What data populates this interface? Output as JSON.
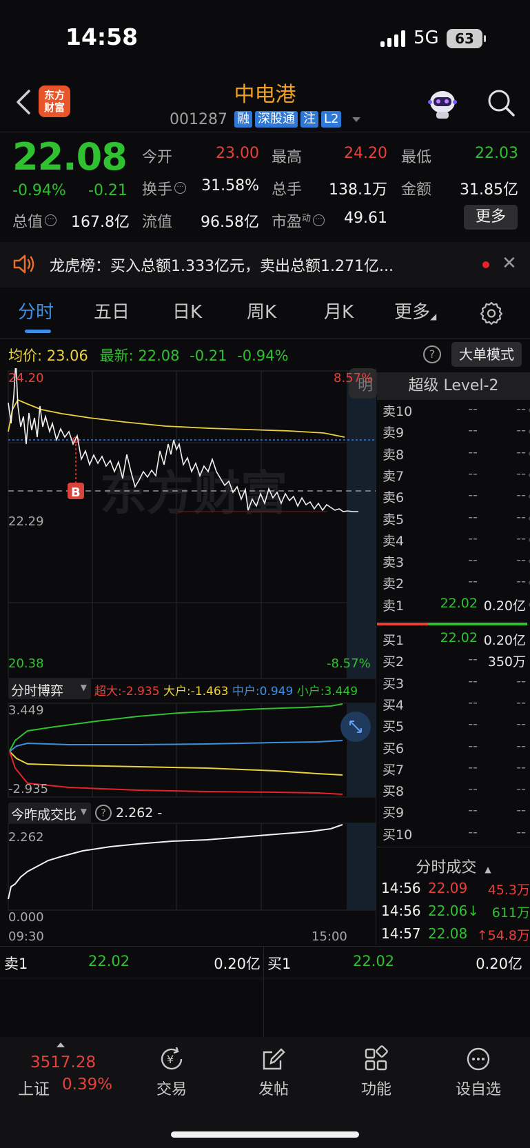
{
  "status": {
    "time": "14:58",
    "network": "5G",
    "battery": "63"
  },
  "header": {
    "stock_name": "中电港",
    "stock_code": "001287",
    "tags": [
      "融",
      "深股通",
      "注",
      "L2"
    ],
    "logo_text": "东方财富"
  },
  "quote": {
    "price": "22.08",
    "pct": "-0.94%",
    "change": "-0.21",
    "open_label": "今开",
    "open": "23.00",
    "high_label": "最高",
    "high": "24.20",
    "low_label": "最低",
    "low": "22.03",
    "turnover_label": "换手",
    "turnover": "31.58%",
    "volume_label": "总手",
    "volume": "138.1万",
    "amount_label": "金额",
    "amount": "31.85亿",
    "mktcap_label": "总值",
    "mktcap": "167.8亿",
    "float_label": "流值",
    "float_cap": "96.58亿",
    "pe_label": "市盈",
    "pe_super": "动",
    "pe": "49.61",
    "more_label": "更多"
  },
  "notice": {
    "text": "龙虎榜：买入总额1.333亿元，卖出总额1.271亿..."
  },
  "tabs": [
    "分时",
    "五日",
    "日K",
    "周K",
    "月K",
    "更多"
  ],
  "avg_row": {
    "avg_label": "均价:",
    "avg": "23.06",
    "latest_label": "最新:",
    "latest": "22.08",
    "chg": "-0.21",
    "pct": "-0.94%",
    "big_order_label": "大单模式"
  },
  "chart": {
    "top_price": "24.20",
    "top_pct": "8.57%",
    "ref_price": "22.29",
    "bottom_price": "20.38",
    "bottom_pct": "-8.57%",
    "ming_label": "明",
    "buy_marker": "B",
    "watermark": "东方财富",
    "time_start": "09:30",
    "time_end": "15:00"
  },
  "game_panel": {
    "title": "分时博弈",
    "super_label": "超大:",
    "super": "-2.935",
    "big_label": "大户:",
    "big": "-1.463",
    "mid_label": "中户:",
    "mid": "0.949",
    "small_label": "小户:",
    "small": "3.449",
    "ymax": "3.449",
    "ymin": "-2.935",
    "colors": {
      "super": "#e8202a",
      "big": "#e9d23c",
      "mid": "#3d8fe6",
      "small": "#2fc12f"
    }
  },
  "ratio_panel": {
    "title": "今昨成交比",
    "value": "2.262 -",
    "ymax": "2.262",
    "ymin": "0.000"
  },
  "level2": {
    "title": "超级 Level-2",
    "asks": [
      {
        "label": "卖10",
        "price": "--",
        "vol": "--"
      },
      {
        "label": "卖9",
        "price": "--",
        "vol": "--"
      },
      {
        "label": "卖8",
        "price": "--",
        "vol": "--"
      },
      {
        "label": "卖7",
        "price": "--",
        "vol": "--"
      },
      {
        "label": "卖6",
        "price": "--",
        "vol": "--"
      },
      {
        "label": "卖5",
        "price": "--",
        "vol": "--"
      },
      {
        "label": "卖4",
        "price": "--",
        "vol": "--"
      },
      {
        "label": "卖3",
        "price": "--",
        "vol": "--"
      },
      {
        "label": "卖2",
        "price": "--",
        "vol": "--"
      },
      {
        "label": "卖1",
        "price": "22.02",
        "vol": "0.20亿"
      }
    ],
    "bids": [
      {
        "label": "买1",
        "price": "22.02",
        "vol": "0.20亿"
      },
      {
        "label": "买2",
        "price": "--",
        "vol": "350万"
      },
      {
        "label": "买3",
        "price": "--",
        "vol": "--"
      },
      {
        "label": "买4",
        "price": "--",
        "vol": "--"
      },
      {
        "label": "买5",
        "price": "--",
        "vol": "--"
      },
      {
        "label": "买6",
        "price": "--",
        "vol": "--"
      },
      {
        "label": "买7",
        "price": "--",
        "vol": "--"
      },
      {
        "label": "买8",
        "price": "--",
        "vol": "--"
      },
      {
        "label": "买9",
        "price": "--",
        "vol": "--"
      },
      {
        "label": "买10",
        "price": "--",
        "vol": "--"
      }
    ],
    "ticks_title": "分时成交",
    "ticks": [
      {
        "time": "14:56",
        "price": "22.09",
        "vol": "45.3万"
      },
      {
        "time": "14:56",
        "price": "22.06↓",
        "vol": "611万"
      },
      {
        "time": "14:57",
        "price": "22.08",
        "vol": "↑54.8万"
      }
    ]
  },
  "strip": {
    "ask_label": "卖1",
    "ask_price": "22.02",
    "ask_vol": "0.20亿",
    "bid_label": "买1",
    "bid_price": "22.02",
    "bid_vol": "0.20亿"
  },
  "bottom_nav": {
    "index_value": "3517.28",
    "index_name": "上证",
    "index_pct": "0.39%",
    "items": [
      "交易",
      "发帖",
      "功能",
      "设自选"
    ]
  }
}
